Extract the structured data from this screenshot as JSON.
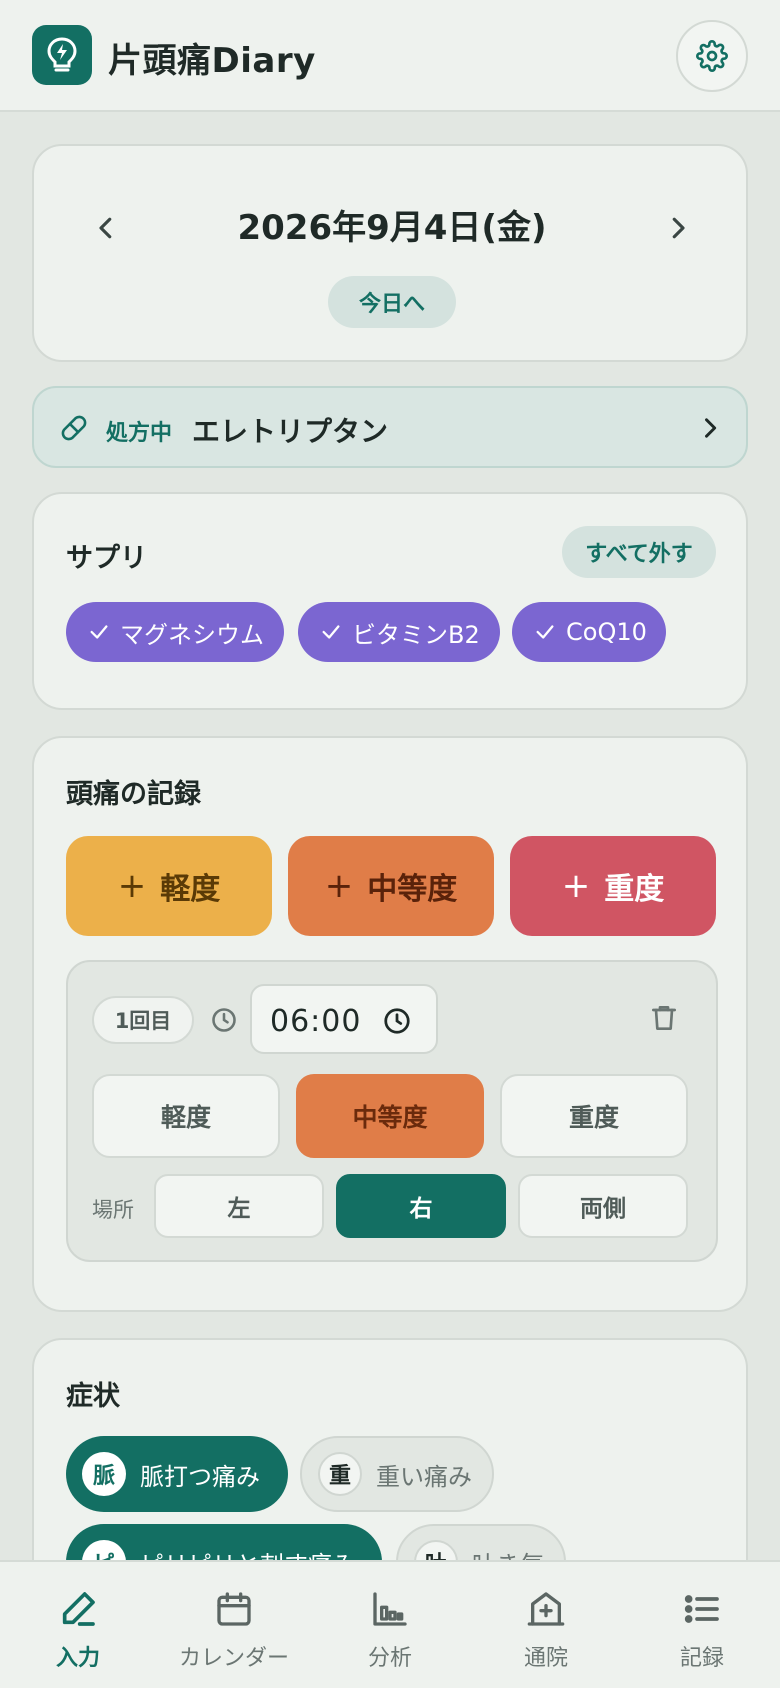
{
  "header": {
    "app_title": "片頭痛Diary"
  },
  "date_nav": {
    "date": "2026年9月4日(金)",
    "today_label": "今日へ"
  },
  "prescription": {
    "tag": "処方中",
    "drug": "エレトリプタン"
  },
  "supplements": {
    "title": "サプリ",
    "clear_all_label": "すべて外す",
    "items": [
      {
        "label": "マグネシウム",
        "checked": true
      },
      {
        "label": "ビタミンB2",
        "checked": true
      },
      {
        "label": "CoQ10",
        "checked": true
      }
    ]
  },
  "headache_record": {
    "title": "頭痛の記録",
    "add_buttons": [
      {
        "symbol": "+",
        "label": "軽度",
        "color": "#ecb04a"
      },
      {
        "symbol": "+",
        "label": "中等度",
        "color": "#e07d48"
      },
      {
        "symbol": "+",
        "label": "重度",
        "color": "#d05563"
      }
    ],
    "episode": {
      "count_label": "1回目",
      "time": "06:00",
      "severity_options": [
        "軽度",
        "中等度",
        "重度"
      ],
      "selected_severity": "中等度",
      "location_label": "場所",
      "location_options": [
        "左",
        "右",
        "両側"
      ],
      "selected_location": "右"
    }
  },
  "symptoms": {
    "title": "症状",
    "items": [
      {
        "kanji": "脈",
        "label": "脈打つ痛み",
        "selected": true
      },
      {
        "kanji": "重",
        "label": "重い痛み",
        "selected": false
      },
      {
        "kanji": "ピ",
        "label": "ピリピリと刺す痛み",
        "selected": true
      },
      {
        "kanji": "吐",
        "label": "吐き気",
        "selected": false
      }
    ]
  },
  "bottom_nav": {
    "items": [
      {
        "label": "入力",
        "icon": "pencil-icon",
        "active": true
      },
      {
        "label": "カレンダー",
        "icon": "calendar-icon",
        "active": false
      },
      {
        "label": "分析",
        "icon": "bar-chart-icon",
        "active": false
      },
      {
        "label": "通院",
        "icon": "hospital-icon",
        "active": false
      },
      {
        "label": "記録",
        "icon": "list-icon",
        "active": false
      }
    ]
  },
  "colors": {
    "primary": "#136f63",
    "supplement_chip": "#7b66d1",
    "mild": "#ecb04a",
    "moderate": "#e07d48",
    "severe": "#d05563"
  }
}
